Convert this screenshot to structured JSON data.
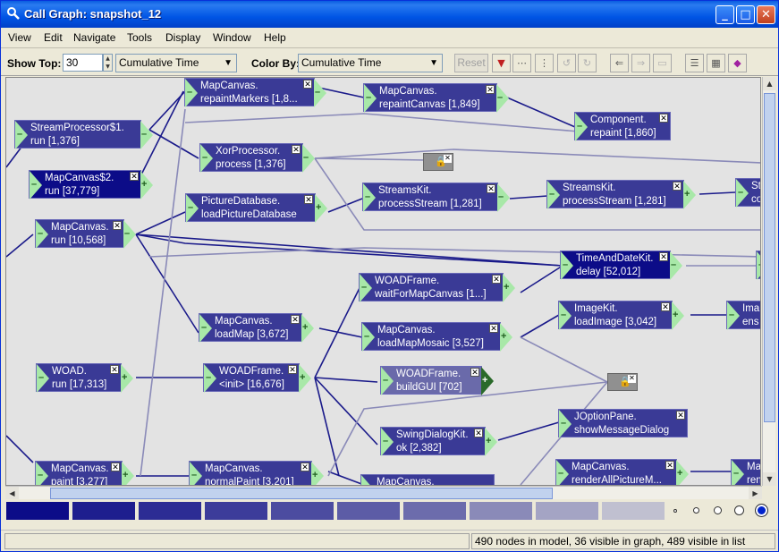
{
  "window": {
    "title": "Call Graph: snapshot_12",
    "min": "_",
    "max": "□",
    "close": "✕"
  },
  "menu": [
    "View",
    "Edit",
    "Navigate",
    "Tools",
    "Display",
    "Window",
    "Help"
  ],
  "toolbar": {
    "show_top_label": "Show Top:",
    "show_top_value": "30",
    "show_by_value": "Cumulative Time",
    "color_by_label": "Color By:",
    "color_by_value": "Cumulative Time",
    "reset_label": "Reset"
  },
  "nodes": [
    {
      "id": "n1",
      "l1": "MapCanvas.",
      "l2": "repaintMarkers [1,8...",
      "tone": "mid"
    },
    {
      "id": "n2",
      "l1": "MapCanvas.",
      "l2": "repaintCanvas [1,849]",
      "tone": "mid"
    },
    {
      "id": "n3",
      "l1": "Component.",
      "l2": "repaint [1,860]",
      "tone": "mid"
    },
    {
      "id": "n4",
      "l1": "StreamProcessor$1.",
      "l2": "run [1,376]",
      "tone": "mid"
    },
    {
      "id": "n5",
      "l1": "XorProcessor.",
      "l2": "process [1,376]",
      "tone": "mid"
    },
    {
      "id": "n6",
      "l1": "MapCanvas$2.",
      "l2": "run [37,779]",
      "tone": "dark"
    },
    {
      "id": "n7",
      "l1": "PictureDatabase.",
      "l2": "loadPictureDatabase",
      "tone": "mid"
    },
    {
      "id": "n8",
      "l1": "StreamsKit.",
      "l2": "processStream [1,281]",
      "tone": "mid"
    },
    {
      "id": "n9",
      "l1": "StreamsKit.",
      "l2": "processStream [1,281]",
      "tone": "mid"
    },
    {
      "id": "n10",
      "l1": "St",
      "l2": "co",
      "tone": "mid"
    },
    {
      "id": "n11",
      "l1": "MapCanvas.",
      "l2": "run [10,568]",
      "tone": "mid"
    },
    {
      "id": "n12",
      "l1": "TimeAndDateKit.",
      "l2": "delay [52,012]",
      "tone": "dark"
    },
    {
      "id": "n13",
      "l1": "WOADFrame.",
      "l2": "waitForMapCanvas [1...]",
      "tone": "mid"
    },
    {
      "id": "n14",
      "l1": "MapCanvas.",
      "l2": "loadMap [3,672]",
      "tone": "mid"
    },
    {
      "id": "n15",
      "l1": "MapCanvas.",
      "l2": "loadMapMosaic [3,527]",
      "tone": "mid"
    },
    {
      "id": "n16",
      "l1": "ImageKit.",
      "l2": "loadImage [3,042]",
      "tone": "mid"
    },
    {
      "id": "n17",
      "l1": "Ima",
      "l2": "ens",
      "tone": "mid"
    },
    {
      "id": "n18",
      "l1": "WOAD.",
      "l2": "run [17,313]",
      "tone": "mid"
    },
    {
      "id": "n19",
      "l1": "WOADFrame.",
      "l2": "<init> [16,676]",
      "tone": "mid"
    },
    {
      "id": "n20",
      "l1": "WOADFrame.",
      "l2": "buildGUI [702]",
      "tone": "light"
    },
    {
      "id": "n21",
      "l1": "JOptionPane.",
      "l2": "showMessageDialog",
      "tone": "mid"
    },
    {
      "id": "n22",
      "l1": "SwingDialogKit.",
      "l2": "ok [2,382]",
      "tone": "mid"
    },
    {
      "id": "n23",
      "l1": "MapCanvas.",
      "l2": "paint [3,277]",
      "tone": "mid"
    },
    {
      "id": "n24",
      "l1": "MapCanvas.",
      "l2": "normalPaint [3,201]",
      "tone": "mid"
    },
    {
      "id": "n25",
      "l1": "MapCanvas.",
      "l2": "",
      "tone": "mid"
    },
    {
      "id": "n26",
      "l1": "MapCanvas.",
      "l2": "renderAllPictureM...",
      "tone": "mid"
    },
    {
      "id": "n27",
      "l1": "Ma",
      "l2": "ren",
      "tone": "mid"
    }
  ],
  "legend_colors": [
    "#0c0c88",
    "#1e1e8e",
    "#2c2c94",
    "#3c3c9a",
    "#4c4ca0",
    "#5c5ca6",
    "#6c6cac",
    "#8a8ab8",
    "#a4a4c4",
    "#c0c0d0"
  ],
  "status": {
    "right": "490 nodes in model, 36 visible in graph, 489 visible in list"
  }
}
